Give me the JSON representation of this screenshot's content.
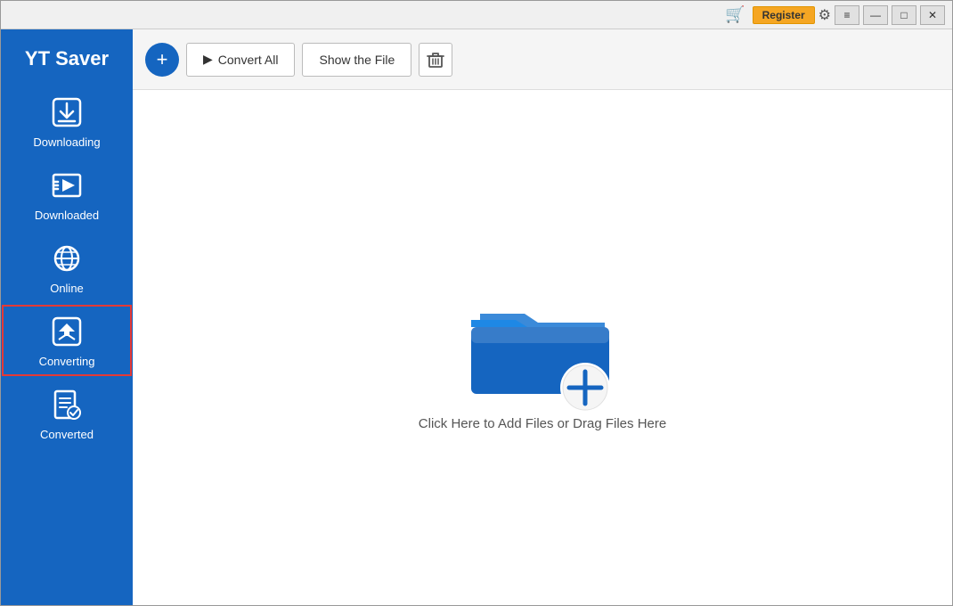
{
  "app": {
    "title": "YT Saver"
  },
  "titlebar": {
    "register_label": "Register",
    "cart_icon": "🛒",
    "gear_icon": "⚙",
    "minimize_icon": "—",
    "maximize_icon": "□",
    "restore_icon": "❐",
    "close_icon": "✕"
  },
  "toolbar": {
    "add_icon": "+",
    "convert_all_icon": "▶",
    "convert_all_label": "Convert All",
    "show_file_label": "Show the File",
    "delete_icon": "🗑"
  },
  "sidebar": {
    "items": [
      {
        "id": "downloading",
        "label": "Downloading",
        "active": false
      },
      {
        "id": "downloaded",
        "label": "Downloaded",
        "active": false
      },
      {
        "id": "online",
        "label": "Online",
        "active": false
      },
      {
        "id": "converting",
        "label": "Converting",
        "active": true
      },
      {
        "id": "converted",
        "label": "Converted",
        "active": false
      }
    ]
  },
  "main": {
    "drop_text": "Click Here to Add Files or Drag Files Here"
  },
  "colors": {
    "sidebar_bg": "#1565c0",
    "active_border": "#e53935",
    "accent": "#f5a623"
  }
}
